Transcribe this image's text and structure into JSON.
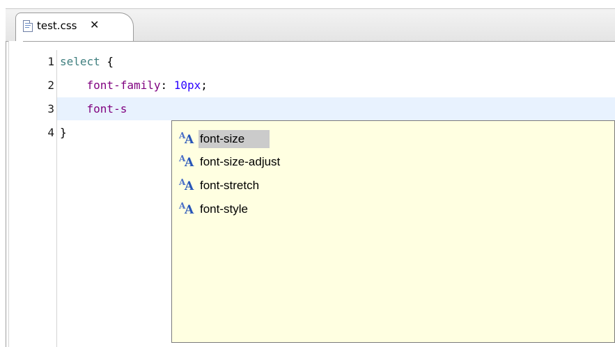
{
  "editor_tab": {
    "filename": "test.css",
    "close_glyph": "✕",
    "file_icon": "css-file-icon"
  },
  "code_lines": [
    {
      "number": "1",
      "selector": "select",
      "rest": " {"
    },
    {
      "number": "2",
      "indent": "    ",
      "property": "font-family",
      "sep": ": ",
      "value": "10px",
      "end": ";"
    },
    {
      "number": "3",
      "indent": "    ",
      "property": "font-s"
    },
    {
      "number": "4",
      "text": "}"
    }
  ],
  "content_assist": {
    "selected_index": 0,
    "item_icon": "css-property-aa-icon",
    "items": [
      {
        "label": "font-size"
      },
      {
        "label": "font-size-adjust"
      },
      {
        "label": "font-stretch"
      },
      {
        "label": "font-style"
      }
    ]
  },
  "colors": {
    "selector": "#3f7f7f",
    "property": "#7f007f",
    "value": "#2a00ff",
    "current_line": "#e8f2fe",
    "popup_bg": "#ffffe1",
    "selected_item": "#cbcbcb"
  }
}
